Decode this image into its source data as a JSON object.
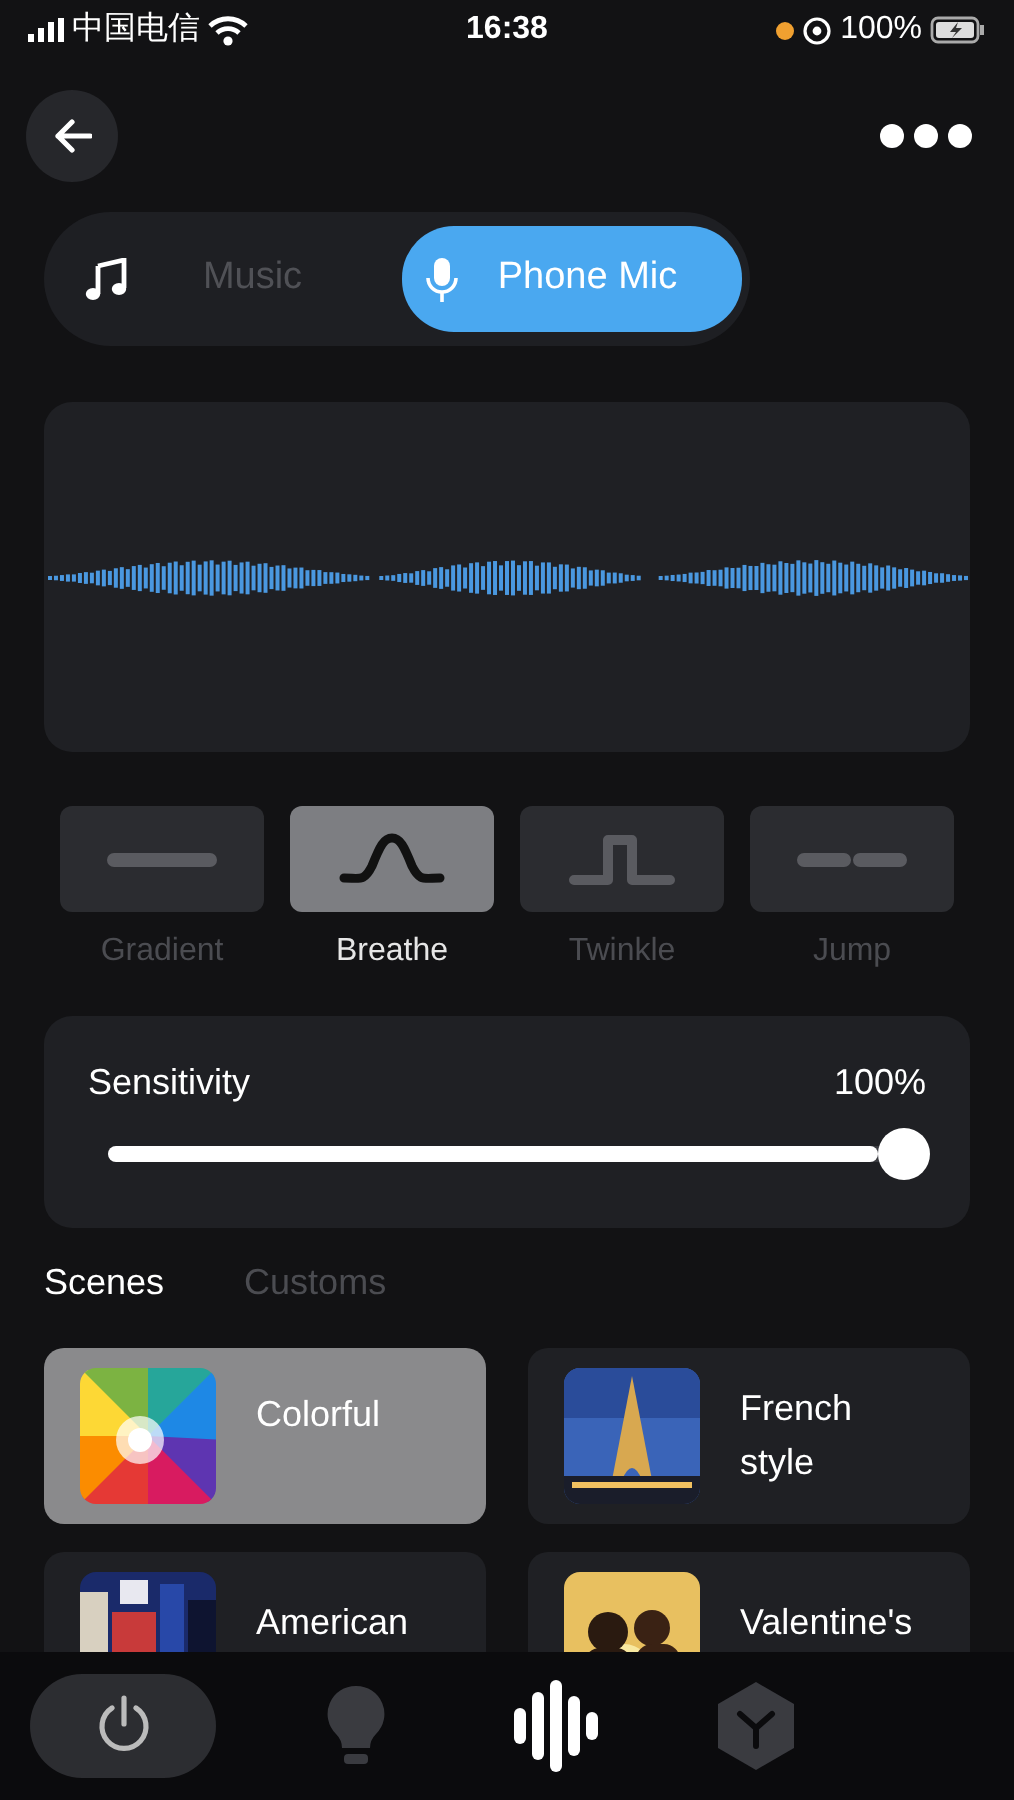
{
  "status_bar": {
    "carrier": "中国电信",
    "time": "16:38",
    "battery": "100%"
  },
  "modes": [
    {
      "kind": "music",
      "label": "Music",
      "selected": false
    },
    {
      "kind": "mic",
      "label": "Phone Mic",
      "selected": true
    }
  ],
  "effects": [
    {
      "kind": "flat",
      "label": "Gradient",
      "selected": false
    },
    {
      "kind": "wave",
      "label": "Breathe",
      "selected": true
    },
    {
      "kind": "pulse",
      "label": "Twinkle",
      "selected": false
    },
    {
      "kind": "dash",
      "label": "Jump",
      "selected": false
    }
  ],
  "sensitivity": {
    "label": "Sensitivity",
    "reading": "100%",
    "level": 1
  },
  "scene_tabs": [
    {
      "label": "Scenes",
      "selected": true
    },
    {
      "label": "Customs",
      "selected": false
    }
  ],
  "scenes": [
    {
      "name": "Colorful",
      "selected": true,
      "kind": "spectrum"
    },
    {
      "name": "French style",
      "selected": false,
      "kind": "tower"
    },
    {
      "name": "American",
      "selected": false,
      "kind": "city"
    },
    {
      "name": "Valentine's",
      "selected": false,
      "kind": "sunset"
    }
  ],
  "bottom_nav": [
    {
      "kind": "bulb",
      "selected": false
    },
    {
      "kind": "sound",
      "selected": true
    },
    {
      "kind": "cube",
      "selected": false
    }
  ]
}
